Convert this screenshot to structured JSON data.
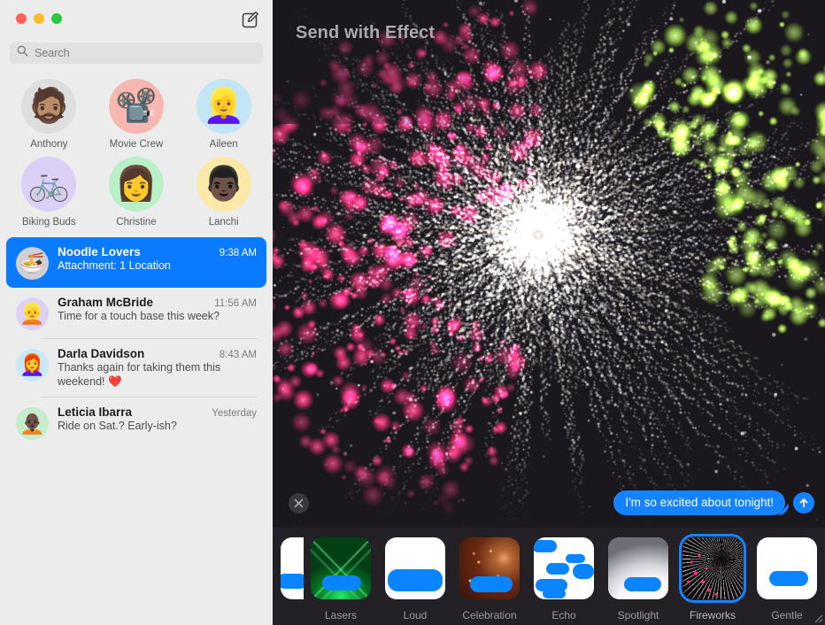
{
  "window": {
    "traffic_lights": [
      {
        "name": "close",
        "color": "#ff5f57"
      },
      {
        "name": "minimize",
        "color": "#febc2e"
      },
      {
        "name": "zoom",
        "color": "#28c840"
      }
    ],
    "compose_icon": "compose-icon"
  },
  "search": {
    "placeholder": "Search",
    "value": "",
    "icon": "search-icon"
  },
  "pinned": [
    {
      "label": "Anthony",
      "emoji": "🧔🏽",
      "bg": "#dedede"
    },
    {
      "label": "Movie Crew",
      "emoji": "📽️",
      "bg": "#f8b8b2"
    },
    {
      "label": "Aileen",
      "emoji": "👱‍♀️",
      "bg": "#c2e6f5"
    },
    {
      "label": "Biking Buds",
      "emoji": "🚲",
      "bg": "#ddd0f7"
    },
    {
      "label": "Christine",
      "emoji": "👩",
      "bg": "#b9f0c8"
    },
    {
      "label": "Lanchi",
      "emoji": "👨🏿",
      "bg": "#fbe9a8"
    }
  ],
  "conversations": [
    {
      "name": "Noodle Lovers",
      "time": "9:38 AM",
      "preview": "Attachment: 1 Location",
      "emoji": "🍜",
      "bg": "#cfcfd4",
      "selected": true
    },
    {
      "name": "Graham McBride",
      "time": "11:56 AM",
      "preview": "Time for a touch base this week?",
      "emoji": "👱",
      "bg": "#ded0f7",
      "selected": false
    },
    {
      "name": "Darla Davidson",
      "time": "8:43 AM",
      "preview": "Thanks again for taking them this weekend! ❤️",
      "emoji": "👩‍🦰",
      "bg": "#c9e9f8",
      "selected": false
    },
    {
      "name": "Leticia Ibarra",
      "time": "Yesterday",
      "preview": "Ride on Sat.? Early-ish?",
      "emoji": "🧑🏿‍🦲",
      "bg": "#c6edc9",
      "selected": false
    }
  ],
  "main": {
    "title": "Send with Effect",
    "close_icon": "close-icon",
    "send_icon": "send-arrow-icon",
    "message": "I'm so excited about tonight!",
    "accent_blue": "#1582ff",
    "effect_background": "fireworks"
  },
  "effects": [
    {
      "label": "",
      "kind": "partial",
      "selected": false
    },
    {
      "label": "Lasers",
      "kind": "lasers",
      "selected": false
    },
    {
      "label": "Loud",
      "kind": "loud",
      "selected": false
    },
    {
      "label": "Celebration",
      "kind": "celebration",
      "selected": false
    },
    {
      "label": "Echo",
      "kind": "echo",
      "selected": false
    },
    {
      "label": "Spotlight",
      "kind": "spotlight",
      "selected": false
    },
    {
      "label": "Fireworks",
      "kind": "fireworks",
      "selected": true
    },
    {
      "label": "Gentle",
      "kind": "gentle",
      "selected": false
    }
  ]
}
